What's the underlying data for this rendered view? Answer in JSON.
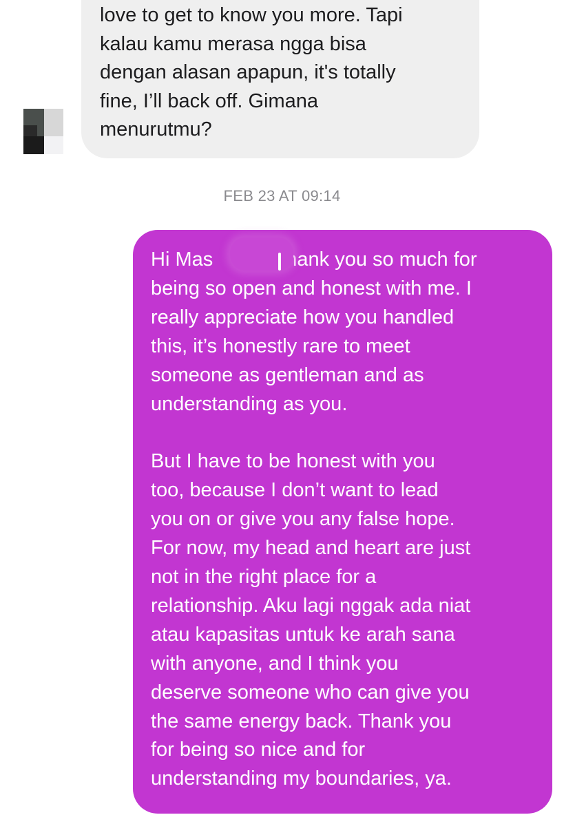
{
  "conversation": {
    "received_message": {
      "lines": [
        "love to get to know you more. Tapi",
        "kalau kamu merasa ngga bisa",
        "dengan alasan apapun, it's totally",
        "fine, I’ll back off. Gimana",
        "menurutmu?"
      ]
    },
    "timestamp": "FEB 23 AT 09:14",
    "sent_message": {
      "paragraph_1": [
        "Hi Mas",
        "thank you so much for",
        "being so open and honest with me. I",
        "really appreciate how you handled",
        "this, it’s honestly rare to meet",
        "someone as gentleman and as",
        "understanding as you."
      ],
      "paragraph_2": [
        "But I have to be honest with you",
        "too, because I don’t want to lead",
        "you on or give you any false hope.",
        "For now, my head and heart are just",
        "not in the right place for a",
        "relationship. Aku lagi nggak ada niat",
        "atau kapasitas untuk ke arah sana",
        "with anyone, and I think you",
        "deserve someone who can give you",
        "the same energy back. Thank you",
        "for being so nice and for",
        "understanding my boundaries, ya."
      ]
    }
  },
  "colors": {
    "received_bubble": "#efefef",
    "sent_bubble": "#c236d1",
    "timestamp_text": "#8a8a8e"
  }
}
